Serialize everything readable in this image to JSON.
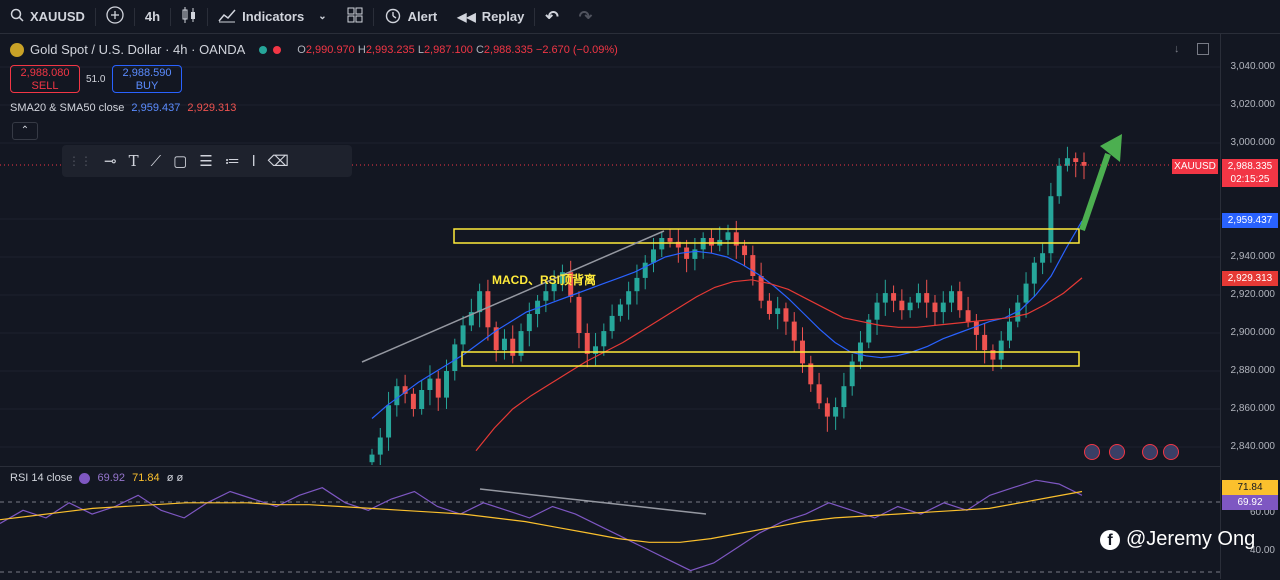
{
  "toolbar": {
    "symbol": "XAUUSD",
    "interval": "4h",
    "indicators_label": "Indicators",
    "alert_label": "Alert",
    "replay_label": "Replay"
  },
  "legend": {
    "title": "Gold Spot / U.S. Dollar · 4h · OANDA",
    "open_label": "O",
    "open": "2,990.970",
    "high_label": "H",
    "high": "2,993.235",
    "low_label": "L",
    "low": "2,987.100",
    "close_label": "C",
    "close": "2,988.335",
    "change": "−2.670 (−0.09%)"
  },
  "trade": {
    "sell_price": "2,988.080",
    "sell_label": "SELL",
    "spread": "51.0",
    "buy_price": "2,988.590",
    "buy_label": "BUY"
  },
  "sma": {
    "label": "SMA20 & SMA50 close",
    "sma20": "2,959.437",
    "sma50": "2,929.313"
  },
  "rsi": {
    "label": "RSI 14 close",
    "value": "69.92",
    "ma": "71.84",
    "extra": "ø ø"
  },
  "annotation": "MACD、RSI顶背离",
  "watermark": "@Jeremy Ong",
  "price_tags": {
    "symbol": "XAUUSD",
    "last": "2,988.335",
    "countdown": "02:15:25",
    "sma20": "2,959.437",
    "sma50": "2,929.313",
    "rsi_ma": "71.84",
    "rsi": "69.92"
  },
  "colors": {
    "up": "#26a69a",
    "down": "#ef5350",
    "sma20": "#2962ff",
    "sma50": "#e53935",
    "box": "#ffeb3b",
    "rsi": "#7e57c2",
    "rsi_ma": "#fbc02d",
    "arrow": "#4caf50"
  },
  "chart_data": [
    {
      "type": "candlestick",
      "title": "Gold Spot / U.S. Dollar · 4h · OANDA",
      "ylim": [
        2830,
        3050
      ],
      "y_ticks": [
        2840,
        2860,
        2880,
        2900,
        2920,
        2940,
        2960,
        3000,
        3020,
        3040
      ],
      "y_tick_labels": [
        "2,840.000",
        "2,860.000",
        "2,880.000",
        "2,900.000",
        "2,920.000",
        "2,940.000",
        "2,960.000",
        "3,000.000",
        "3,020.000",
        "3,040.000"
      ],
      "series": [
        {
          "name": "XAUUSD",
          "values": [
            2836,
            2845,
            2862,
            2872,
            2868,
            2860,
            2870,
            2876,
            2866,
            2880,
            2894,
            2904,
            2911,
            2922,
            2903,
            2891,
            2897,
            2888,
            2901,
            2910,
            2917,
            2922,
            2926,
            2932,
            2919,
            2900,
            2889,
            2893,
            2901,
            2909,
            2915,
            2922,
            2929,
            2937,
            2944,
            2950,
            2948,
            2945,
            2939,
            2944,
            2950,
            2946,
            2949,
            2953,
            2946,
            2941,
            2930,
            2917,
            2910,
            2913,
            2906,
            2896,
            2884,
            2873,
            2863,
            2856,
            2861,
            2872,
            2885,
            2895,
            2907,
            2916,
            2921,
            2917,
            2912,
            2916,
            2921,
            2916,
            2911,
            2916,
            2922,
            2912,
            2906,
            2899,
            2891,
            2886,
            2896,
            2906,
            2916,
            2926,
            2937,
            2942,
            2972,
            2988,
            2992,
            2990,
            2988
          ]
        },
        {
          "name": "SMA20",
          "values": [
            2855,
            2862,
            2868,
            2874,
            2879,
            2884,
            2889,
            2895,
            2901,
            2906,
            2911,
            2914,
            2917,
            2920,
            2923,
            2926,
            2929,
            2932,
            2936,
            2940,
            2942,
            2943,
            2942,
            2940,
            2936,
            2931,
            2925,
            2918,
            2910,
            2902,
            2895,
            2890,
            2888,
            2887,
            2888,
            2890,
            2893,
            2897,
            2900,
            2903,
            2906,
            2908,
            2912,
            2920,
            2930,
            2945,
            2959
          ]
        },
        {
          "name": "SMA50",
          "values": [
            2838,
            2850,
            2860,
            2867,
            2873,
            2879,
            2885,
            2890,
            2895,
            2901,
            2907,
            2913,
            2919,
            2924,
            2927,
            2928,
            2926,
            2923,
            2918,
            2913,
            2908,
            2906,
            2904,
            2903,
            2903,
            2904,
            2905,
            2906,
            2907,
            2908,
            2910,
            2915,
            2921,
            2929
          ]
        }
      ],
      "annotations": [
        "MACD、RSI顶背离"
      ]
    },
    {
      "type": "line",
      "title": "RSI 14 close",
      "y_ticks": [
        60,
        40
      ],
      "series": [
        {
          "name": "RSI",
          "values": [
            55,
            62,
            58,
            66,
            60,
            64,
            70,
            62,
            58,
            66,
            72,
            68,
            64,
            70,
            74,
            66,
            62,
            68,
            72,
            64,
            60,
            66,
            62,
            58,
            64,
            60,
            54,
            48,
            42,
            36,
            30,
            34,
            42,
            50,
            56,
            60,
            66,
            62,
            58,
            64,
            60,
            66,
            62,
            70,
            74,
            78,
            76,
            70
          ]
        },
        {
          "name": "RSI MA",
          "values": [
            57,
            59,
            61,
            63,
            64,
            65,
            66,
            66,
            66,
            65,
            65,
            64,
            63,
            62,
            61,
            60,
            58,
            56,
            53,
            50,
            47,
            45,
            45,
            47,
            50,
            53,
            56,
            58,
            59,
            60,
            61,
            62,
            63,
            66,
            69,
            72
          ]
        }
      ]
    }
  ]
}
